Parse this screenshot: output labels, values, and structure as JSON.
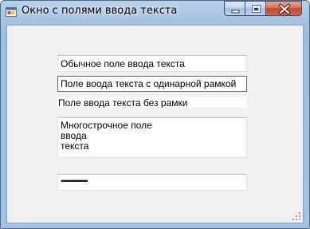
{
  "window": {
    "title": "Окно с полями ввода текста"
  },
  "fields": {
    "standard": "Обычное поле ввода текста",
    "single_border": "Поле воода текста с одинарной рамкой",
    "no_border": "Поле ввода текста без рамки",
    "multiline": "Многострочное поле\nввода\nтекста",
    "password": "••••••••••••••••••••"
  }
}
